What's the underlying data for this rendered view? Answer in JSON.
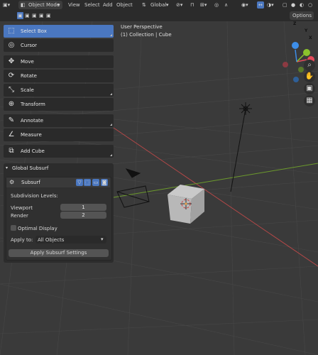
{
  "header": {
    "mode_label": "Object Mode",
    "menu": [
      "View",
      "Select",
      "Add",
      "Object"
    ],
    "transform_orientation": "Global",
    "options_label": "Options"
  },
  "viewport": {
    "title": "User Perspective",
    "subtitle": "(1) Collection | Cube"
  },
  "toolbar": {
    "tools": [
      {
        "label": "Select Box",
        "icon": "select-box-icon",
        "active": true
      },
      {
        "label": "Cursor",
        "icon": "cursor-icon"
      },
      {
        "label": "Move",
        "icon": "move-icon"
      },
      {
        "label": "Rotate",
        "icon": "rotate-icon"
      },
      {
        "label": "Scale",
        "icon": "scale-icon"
      },
      {
        "label": "Transform",
        "icon": "transform-icon"
      },
      {
        "label": "Annotate",
        "icon": "annotate-icon"
      },
      {
        "label": "Measure",
        "icon": "measure-icon"
      },
      {
        "label": "Add Cube",
        "icon": "add-cube-icon"
      }
    ]
  },
  "panel": {
    "title": "Global Subsurf",
    "modifier_name": "Subsurf",
    "levels_label": "Subdivision Levels:",
    "viewport_label": "Viewport",
    "viewport_value": "1",
    "render_label": "Render",
    "render_value": "2",
    "optimal_display_label": "Optimal Display",
    "optimal_display_checked": false,
    "apply_to_label": "Apply to:",
    "apply_to_value": "All Objects",
    "apply_button": "Apply Subsurf Settings"
  },
  "gizmo": {
    "x_label": "X",
    "y_label": "Y",
    "z_label": "Z",
    "colors": {
      "x": "#e44a5a",
      "y": "#8bc32c",
      "z": "#3d8ee8"
    }
  }
}
